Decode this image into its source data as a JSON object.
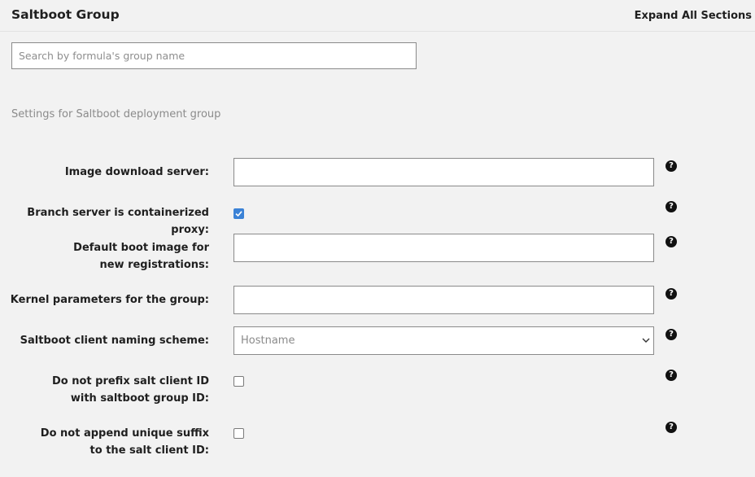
{
  "header": {
    "title": "Saltboot Group",
    "expand_all": "Expand All Sections"
  },
  "search": {
    "placeholder": "Search by formula's group name"
  },
  "section": {
    "description": "Settings for Saltboot deployment group"
  },
  "fields": {
    "image_download_server": {
      "label": "Image download server:",
      "value": ""
    },
    "containerized_proxy": {
      "label": "Branch server is containerized proxy:",
      "checked": true
    },
    "default_boot_image": {
      "label": "Default boot image for new registrations:",
      "value": ""
    },
    "kernel_parameters": {
      "label": "Kernel parameters for the group:",
      "value": ""
    },
    "naming_scheme": {
      "label": "Saltboot client naming scheme:",
      "selected": "Hostname"
    },
    "no_prefix": {
      "label": "Do not prefix salt client ID with saltboot group ID:",
      "checked": false
    },
    "no_suffix": {
      "label": "Do not append unique suffix to the salt client ID:",
      "checked": false
    }
  },
  "icons": {
    "help": "question-circle-icon",
    "select_arrow": "chevron-down-icon",
    "check": "checkmark-icon"
  },
  "colors": {
    "checkbox_checked": "#3b82d6",
    "background": "#f2f2f2"
  }
}
